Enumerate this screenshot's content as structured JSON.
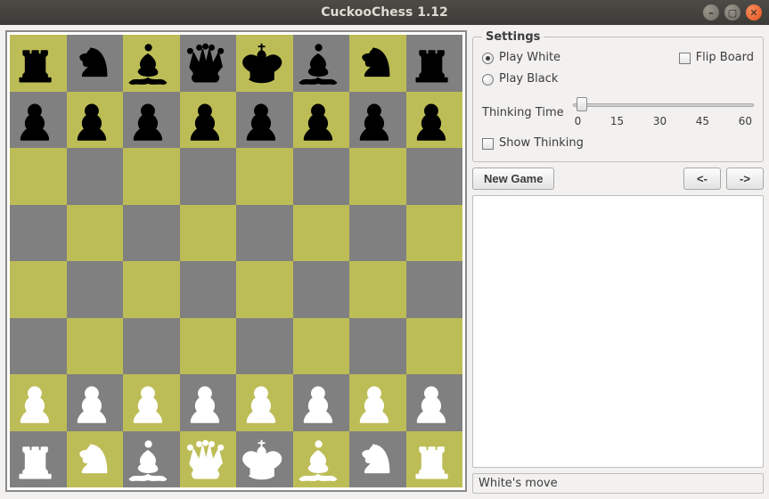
{
  "window": {
    "title": "CuckooChess 1.12"
  },
  "settings": {
    "legend": "Settings",
    "play_white": "Play White",
    "play_black": "Play Black",
    "flip_board": "Flip Board",
    "side": "white",
    "flip_board_checked": false,
    "thinking_time_label": "Thinking Time",
    "thinking_time_value": 3,
    "thinking_time_min": 0,
    "thinking_time_max": 60,
    "ticks": [
      "0",
      "15",
      "30",
      "45",
      "60"
    ],
    "show_thinking": "Show Thinking",
    "show_thinking_checked": false
  },
  "buttons": {
    "new_game": "New Game",
    "back": "<-",
    "forward": "->"
  },
  "history_text": "",
  "status": "White's move",
  "board": {
    "colors": {
      "light": "#bdbd57",
      "dark": "#808080"
    },
    "pieces": [
      [
        "bR",
        "bN",
        "bB",
        "bQ",
        "bK",
        "bB",
        "bN",
        "bR"
      ],
      [
        "bP",
        "bP",
        "bP",
        "bP",
        "bP",
        "bP",
        "bP",
        "bP"
      ],
      [
        "",
        "",
        "",
        "",
        "",
        "",
        "",
        ""
      ],
      [
        "",
        "",
        "",
        "",
        "",
        "",
        "",
        ""
      ],
      [
        "",
        "",
        "",
        "",
        "",
        "",
        "",
        ""
      ],
      [
        "",
        "",
        "",
        "",
        "",
        "",
        "",
        ""
      ],
      [
        "wP",
        "wP",
        "wP",
        "wP",
        "wP",
        "wP",
        "wP",
        "wP"
      ],
      [
        "wR",
        "wN",
        "wB",
        "wQ",
        "wK",
        "wB",
        "wN",
        "wR"
      ]
    ]
  },
  "icons": {
    "minimize": "–",
    "maximize": "▢",
    "close": "✕"
  }
}
